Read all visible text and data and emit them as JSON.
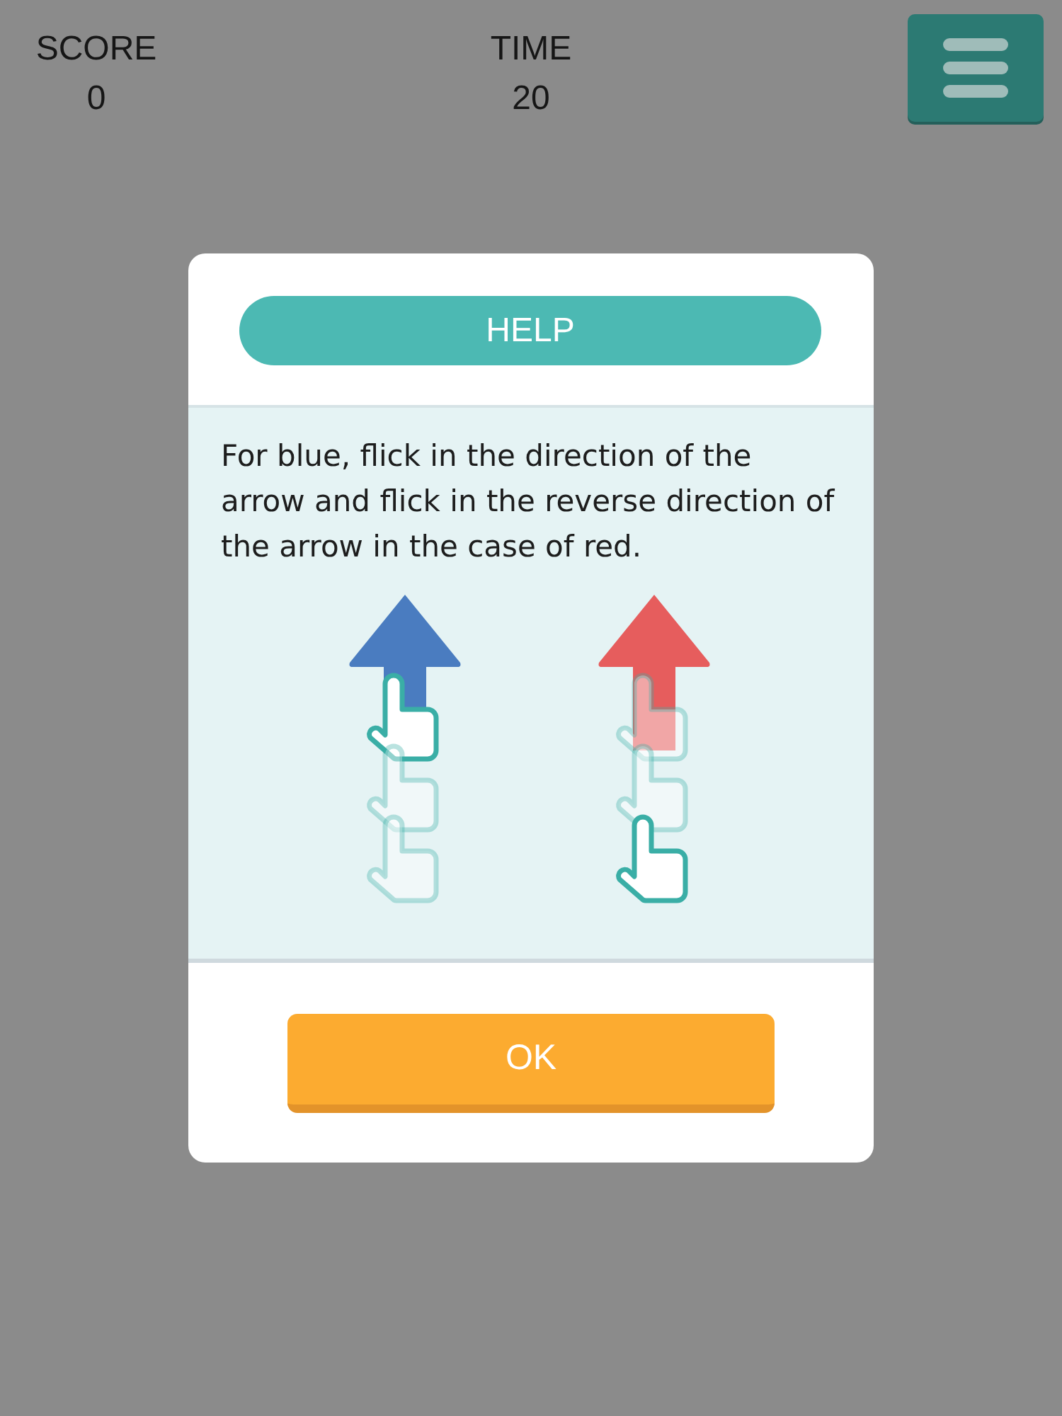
{
  "header": {
    "stats": [
      {
        "label": "SCORE",
        "value": "0"
      },
      {
        "label": "TIME",
        "value": "20"
      }
    ]
  },
  "dialog": {
    "title": "HELP",
    "text": "For blue, flick in the direction of the arrow and flick in the reverse direction of the arrow in the case of red.",
    "illustrations": [
      {
        "kind": "forward",
        "color": "#4a7cc0"
      },
      {
        "kind": "reverse",
        "color": "#e65d5d"
      }
    ],
    "button": "OK"
  }
}
